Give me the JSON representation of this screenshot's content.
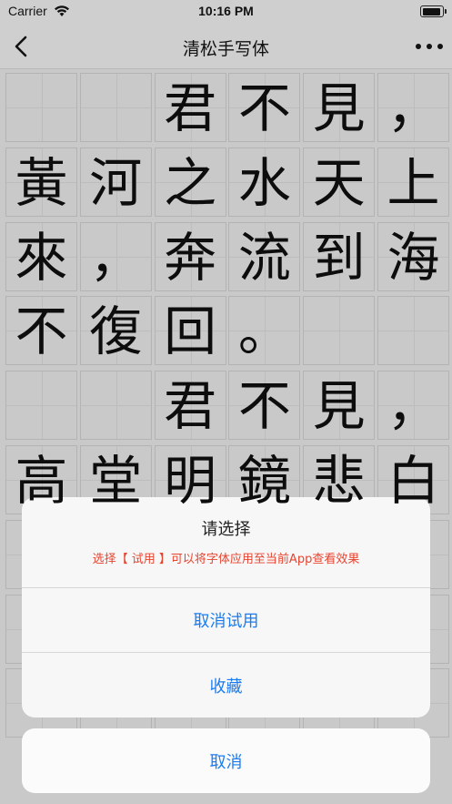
{
  "status_bar": {
    "carrier": "Carrier",
    "time": "10:16 PM",
    "battery_level": 0.95
  },
  "nav": {
    "title": "清松手写体",
    "back_icon": "chevron-left-icon",
    "more_icon": "ellipsis-icon"
  },
  "grid": {
    "rows": [
      [
        "",
        "",
        "君",
        "不",
        "見",
        "，"
      ],
      [
        "黃",
        "河",
        "之",
        "水",
        "天",
        "上"
      ],
      [
        "來",
        "，",
        "奔",
        "流",
        "到",
        "海"
      ],
      [
        "不",
        "復",
        "回",
        "。",
        "",
        ""
      ],
      [
        "",
        "",
        "君",
        "不",
        "見",
        "，"
      ],
      [
        "高",
        "堂",
        "明",
        "鏡",
        "悲",
        "白"
      ],
      [
        "",
        "",
        "",
        "",
        "",
        ""
      ],
      [
        "",
        "",
        "",
        "",
        "",
        ""
      ],
      [
        "",
        "",
        "",
        "",
        "",
        ""
      ]
    ]
  },
  "action_sheet": {
    "title": "请选择",
    "subtitle": "选择【 试用 】可以将字体应用至当前App查看效果",
    "actions": [
      "取消试用",
      "收藏"
    ],
    "cancel": "取消",
    "action_color": "#1b7cf0",
    "subtitle_color": "#e8432f"
  }
}
